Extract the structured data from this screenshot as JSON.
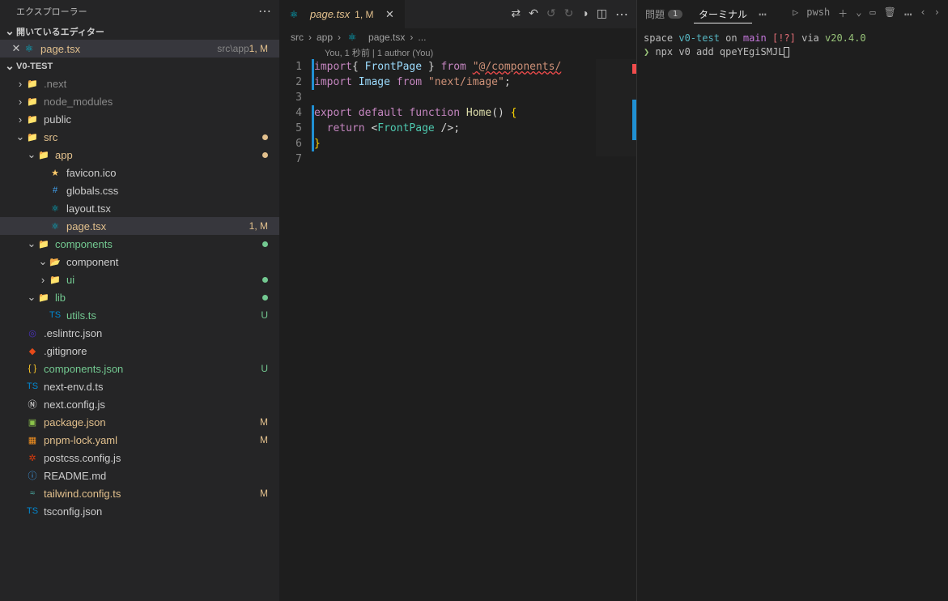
{
  "sidebar": {
    "title": "エクスプローラー",
    "openEditors": {
      "header": "開いているエディター",
      "items": [
        {
          "name": "page.tsx",
          "path": "src\\app",
          "badge": "1, M"
        }
      ]
    },
    "project": "V0-TEST",
    "tree": [
      {
        "depth": 0,
        "chev": "›",
        "icon": "folder",
        "label": ".next",
        "cls": "c-gray"
      },
      {
        "depth": 0,
        "chev": "›",
        "icon": "folder",
        "label": "node_modules",
        "cls": "c-gray"
      },
      {
        "depth": 0,
        "chev": "›",
        "icon": "folder-pub",
        "label": "public"
      },
      {
        "depth": 0,
        "chev": "⌄",
        "icon": "folder-src",
        "label": "src",
        "cls": "c-yellow",
        "dot": "y"
      },
      {
        "depth": 1,
        "chev": "⌄",
        "icon": "folder-app",
        "label": "app",
        "cls": "c-yellow",
        "dot": "y"
      },
      {
        "depth": 2,
        "icon": "star",
        "label": "favicon.ico"
      },
      {
        "depth": 2,
        "icon": "css",
        "label": "globals.css"
      },
      {
        "depth": 2,
        "icon": "react",
        "label": "layout.tsx"
      },
      {
        "depth": 2,
        "icon": "react",
        "label": "page.tsx",
        "cls": "c-yellow",
        "badge": "1, M",
        "selected": true
      },
      {
        "depth": 1,
        "chev": "⌄",
        "icon": "folder-comp",
        "label": "components",
        "cls": "c-green",
        "dot": "g"
      },
      {
        "depth": 2,
        "chev": "⌄",
        "icon": "folder-open",
        "label": "component"
      },
      {
        "depth": 2,
        "chev": "›",
        "icon": "folder",
        "label": "ui",
        "cls": "c-green",
        "dot": "g"
      },
      {
        "depth": 1,
        "chev": "⌄",
        "icon": "folder-lib",
        "label": "lib",
        "cls": "c-green",
        "dot": "g"
      },
      {
        "depth": 2,
        "icon": "ts",
        "label": "utils.ts",
        "cls": "c-green",
        "badgeU": "U"
      },
      {
        "depth": 0,
        "icon": "eslint",
        "label": ".eslintrc.json"
      },
      {
        "depth": 0,
        "icon": "git",
        "label": ".gitignore"
      },
      {
        "depth": 0,
        "icon": "json",
        "label": "components.json",
        "cls": "c-green",
        "badgeU": "U"
      },
      {
        "depth": 0,
        "icon": "ts",
        "label": "next-env.d.ts"
      },
      {
        "depth": 0,
        "icon": "next",
        "label": "next.config.js"
      },
      {
        "depth": 0,
        "icon": "npm",
        "label": "package.json",
        "cls": "c-yellow",
        "badgeM": "M"
      },
      {
        "depth": 0,
        "icon": "pnpm",
        "label": "pnpm-lock.yaml",
        "cls": "c-yellow",
        "badgeM": "M"
      },
      {
        "depth": 0,
        "icon": "postcss",
        "label": "postcss.config.js"
      },
      {
        "depth": 0,
        "icon": "info",
        "label": "README.md"
      },
      {
        "depth": 0,
        "icon": "tailwind",
        "label": "tailwind.config.ts",
        "cls": "c-yellow",
        "badgeM": "M"
      },
      {
        "depth": 0,
        "icon": "tsconf",
        "label": "tsconfig.json"
      }
    ]
  },
  "editor": {
    "tab": {
      "name": "page.tsx",
      "badge": "1, M"
    },
    "crumbs": [
      "src",
      "app",
      "page.tsx",
      "..."
    ],
    "lens": "You, 1 秒前 | 1 author (You)",
    "lines": 7,
    "code": {
      "l1": {
        "a": "import",
        "b": "{ ",
        "c": "FrontPage",
        "d": " }",
        "e": " from ",
        "f": "\"@/components/"
      },
      "l2": {
        "a": "import",
        "b": " ",
        "c": "Image",
        "d": " from ",
        "e": "\"next/image\"",
        "f": ";"
      },
      "l4": {
        "a": "export",
        "b": " default ",
        "c": "function",
        "d": " ",
        "e": "Home",
        "f": "() ",
        "g": "{"
      },
      "l5": {
        "a": "  return",
        "b": " <",
        "c": "FrontPage",
        "d": " />;"
      },
      "l6": {
        "a": "}"
      }
    }
  },
  "terminal": {
    "tabs": {
      "problems": "問題",
      "problemsCount": "1",
      "terminal": "ターミナル",
      "shell": "pwsh"
    },
    "line1": {
      "a": "space ",
      "b": "v0-test",
      "c": " on ",
      "d": "",
      "e": " main ",
      "f": "[!?]",
      "g": " via ",
      "h": "",
      "i": " v20.4.0"
    },
    "line2": {
      "prompt": "❯",
      "cmd": " npx v0 add qpeYEgiSMJL"
    }
  }
}
